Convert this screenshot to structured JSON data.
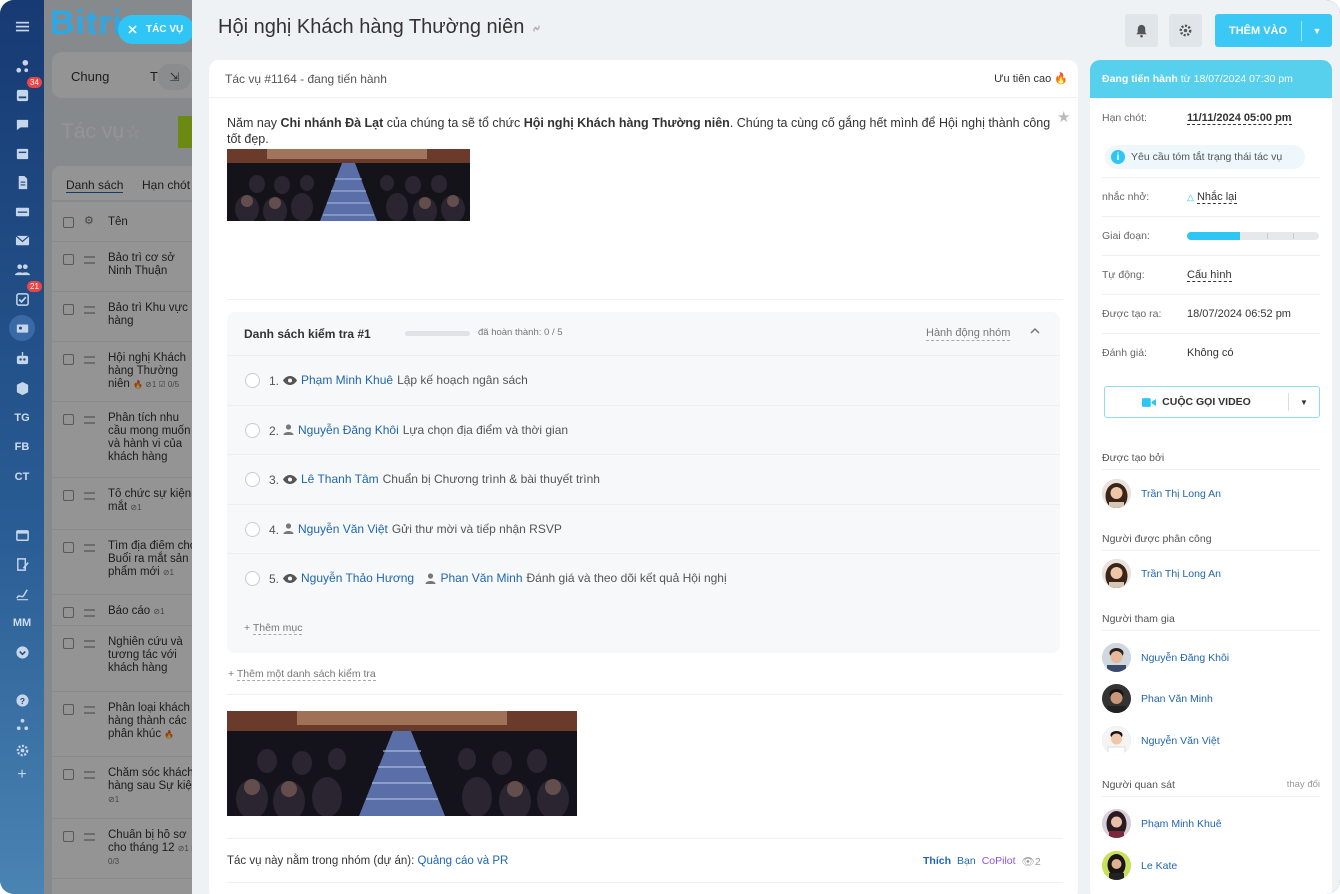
{
  "brand": {
    "logo_text": "Bitri"
  },
  "left_sidebar": {
    "badge_1": "34",
    "badge_2": "21",
    "text_items": [
      "TG",
      "FB",
      "CT",
      "MM"
    ]
  },
  "close_button": {
    "label": "TÁC VỤ"
  },
  "background_list": {
    "tabs": [
      "Chung",
      "Tá"
    ],
    "title": "Tác vụ",
    "subtabs": [
      "Danh sách",
      "Hạn chót"
    ],
    "column_name": "Tên",
    "rows": [
      {
        "text": "Bảo trì cơ sở Ninh Thuận",
        "meta": ""
      },
      {
        "text": "Bảo trì Khu vực hàng",
        "meta": ""
      },
      {
        "text": "Hội nghị Khách hàng Thường niên",
        "meta": "🔥 ⊘1  ☑ 0/5"
      },
      {
        "text": "Phân tích nhu cầu mong muốn và hành vi của khách hàng",
        "meta": ""
      },
      {
        "text": "Tổ chức sự kiện mắt",
        "meta": "⊘1"
      },
      {
        "text": "Tìm địa điểm cho Buổi ra mắt sản phẩm mới",
        "meta": "⊘1"
      },
      {
        "text": "Báo cáo",
        "meta": "⊘1"
      },
      {
        "text": "Nghiên cứu và tương tác với khách hàng",
        "meta": ""
      },
      {
        "text": "Phân loại khách hàng thành các phân khúc",
        "meta": "🔥"
      },
      {
        "text": "Chăm sóc khách hàng sau Sự kiện",
        "meta": "⊘1"
      },
      {
        "text": "Chuẩn bị hồ sơ cho tháng 12",
        "meta": "⊘1  ☑ 0/3"
      }
    ]
  },
  "task": {
    "title": "Hội nghị Khách hàng Thường niên",
    "add_button": "THÊM VÀO",
    "number_status": "Tác vụ #1164 - đang tiến hành",
    "priority": "Ưu tiên cao",
    "desc_1": "Năm nay ",
    "desc_bold_1": "Chi nhánh Đà Lạt",
    "desc_2": " của chúng ta sẽ tổ chức ",
    "desc_bold_2": "Hội nghị Khách hàng Thường niên",
    "desc_3": ". Chúng ta cùng cố gắng hết mình để Hội nghị thành công tốt đẹp.",
    "checklist": {
      "title": "Danh sách kiểm tra #1",
      "progress": 0,
      "done_text": "đã hoàn thành: 0 / 5",
      "group_action": "Hành động nhóm",
      "items": [
        {
          "num": "1.",
          "icon": "eye-icon",
          "person": "Phạm Minh Khuê",
          "icon2": "",
          "person2": "",
          "text": "Lập kế hoạch ngân sách"
        },
        {
          "num": "2.",
          "icon": "user-icon",
          "person": "Nguyễn Đăng Khôi",
          "icon2": "",
          "person2": "",
          "text": "Lựa chọn địa điểm và thời gian"
        },
        {
          "num": "3.",
          "icon": "eye-icon",
          "person": "Lê Thanh Tâm",
          "icon2": "",
          "person2": "",
          "text": "Chuẩn bị Chương trình & bài thuyết trình"
        },
        {
          "num": "4.",
          "icon": "user-icon",
          "person": "Nguyễn Văn Việt",
          "icon2": "",
          "person2": "",
          "text": "Gửi thư mời và tiếp nhận RSVP"
        },
        {
          "num": "5.",
          "icon": "eye-icon",
          "person": "Nguyễn Thảo Hương",
          "icon2": "user-icon",
          "person2": "Phan Văn Minh",
          "text": "Đánh giá và theo dõi kết quả Hội nghị"
        }
      ],
      "add_item": "Thêm mục"
    },
    "add_checklist": "Thêm một danh sách kiểm tra",
    "group_prefix": "Tác vụ này nằm trong nhóm (dự án): ",
    "group_name": "Quảng cáo và PR",
    "like": "Thích",
    "ban": "Bạn",
    "copilot": "CoPilot",
    "views": "2"
  },
  "sidebar": {
    "status_label": "Đang tiến hành",
    "status_since": " từ 18/07/2024 07:30 pm",
    "deadline_label": "Hạn chót:",
    "deadline_value": "11/11/2024 05:00 pm",
    "summary_request": "Yêu cầu tóm tắt trạng thái tác vụ",
    "reminder_label": "nhắc nhở:",
    "reminder_value": "Nhắc lại",
    "stage_label": "Giai đoạn:",
    "stage_progress": 0.4,
    "auto_label": "Tự động:",
    "auto_value": "Cấu hình",
    "created_label": "Được tạo ra:",
    "created_value": "18/07/2024 06:52 pm",
    "rating_label": "Đánh giá:",
    "rating_value": "Không có",
    "video_call": "CUỘC GỌI VIDEO",
    "created_by_label": "Được tạo bởi",
    "created_by": "Trần Thị Long An",
    "assignee_label": "Người được phân công",
    "assignee": "Trần Thị Long An",
    "participants_label": "Người tham gia",
    "participants": [
      "Nguyễn Đăng Khôi",
      "Phan Văn Minh",
      "Nguyễn Văn Việt"
    ],
    "observers_label": "Người quan sát",
    "observers_change": "thay đổi",
    "observers": [
      "Phạm Minh Khuê",
      "Le Kate"
    ]
  },
  "colors": {
    "accent": "#2fc6f6",
    "link": "#2066b0",
    "status": "#56d0ec"
  }
}
